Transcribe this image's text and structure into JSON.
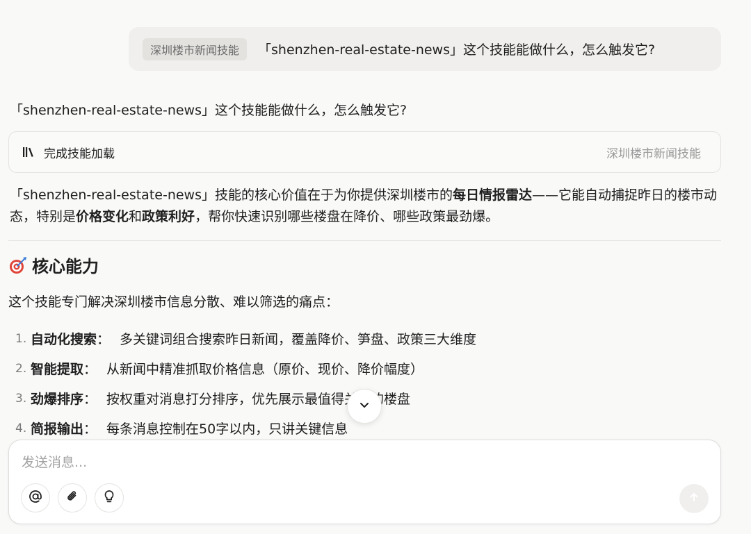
{
  "user_message": {
    "skill_chip": "深圳楼市新闻技能",
    "text": "「shenzhen-real-estate-news」这个技能能做什么，怎么触发它?"
  },
  "assistant": {
    "echo": "「shenzhen-real-estate-news」这个技能能做什么，怎么触发它?",
    "tool_card": {
      "icon": "library-books-icon",
      "label": "完成技能加载",
      "skill_name": "深圳楼市新闻技能"
    },
    "paragraph": {
      "p1": "「shenzhen-real-estate-news」技能的核心价值在于为你提供深圳楼市的",
      "b1": "每日情报雷达",
      "p2": "——它能自动捕捉昨日的楼市动态，特别是",
      "b2": "价格变化",
      "p3": "和",
      "b3": "政策利好",
      "p4": "，帮你快速识别哪些楼盘在降价、哪些政策最劲爆。"
    },
    "section": {
      "icon": "target-icon",
      "title": "核心能力"
    },
    "intro": "这个技能专门解决深圳楼市信息分散、难以筛选的痛点：",
    "items": [
      {
        "num": "1.",
        "title": "自动化搜索",
        "sep": "：",
        "desc": "多关键词组合搜索昨日新闻，覆盖降价、笋盘、政策三大维度"
      },
      {
        "num": "2.",
        "title": "智能提取",
        "sep": "：",
        "desc": "从新闻中精准抓取价格信息（原价、现价、降价幅度）"
      },
      {
        "num": "3.",
        "title": "劲爆排序",
        "sep": "：",
        "desc": "按权重对消息打分排序，优先展示最值得关注的楼盘"
      },
      {
        "num": "4.",
        "title": "简报输出",
        "sep": "：",
        "desc": "每条消息控制在50字以内，只讲关键信息"
      }
    ]
  },
  "composer": {
    "placeholder": "发送消息...",
    "buttons": {
      "mention": "at-sign-icon",
      "attach": "paperclip-icon",
      "idea": "lightbulb-icon",
      "send": "arrow-up-icon"
    }
  },
  "scroll_button": "chevron-down-icon"
}
